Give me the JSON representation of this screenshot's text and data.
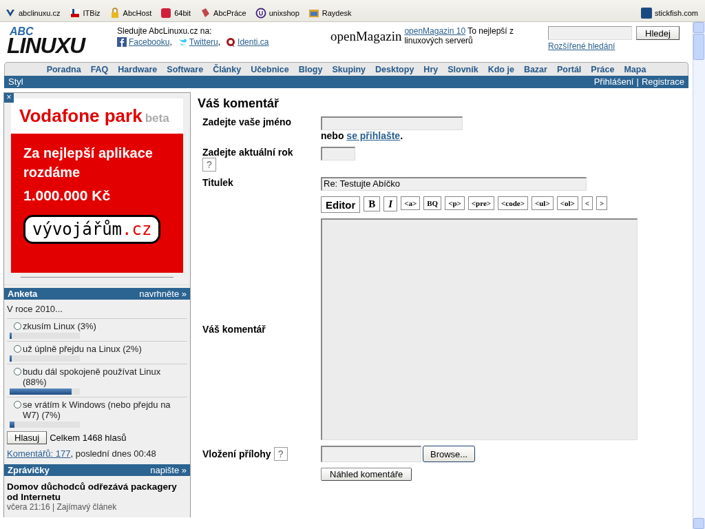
{
  "bookmarks": [
    {
      "label": "abclinuxu.cz",
      "kind": "abc"
    },
    {
      "label": "ITBiz",
      "kind": "itbiz"
    },
    {
      "label": "AbcHost",
      "kind": "lock"
    },
    {
      "label": "64bit",
      "kind": "badge"
    },
    {
      "label": "AbcPráce",
      "kind": "book"
    },
    {
      "label": "unixshop",
      "kind": "ring"
    },
    {
      "label": "Raydesk",
      "kind": "folder"
    }
  ],
  "bookmark_right": {
    "label": "stickfish.com"
  },
  "header": {
    "logo_top": "ABC",
    "logo_bottom": "LINUXU",
    "follow_title": "Sledujte AbcLinuxu.cz na:",
    "follow": [
      {
        "label": "Facebooku",
        "punct": ",",
        "kind": "facebook"
      },
      {
        "label": "Twitteru",
        "punct": ",",
        "kind": "twitter"
      },
      {
        "label": "Identi.ca",
        "kind": "identica"
      }
    ],
    "magazine_logo": "openMagazin",
    "magazine_link": "openMagazin 10",
    "magazine_text": "To nejlepší z linuxových serverů",
    "search_button": "Hledej",
    "search_link": "Rozšířené hledání"
  },
  "nav": [
    "Poradna",
    "FAQ",
    "Hardware",
    "Software",
    "Články",
    "Učebnice",
    "Blogy",
    "Skupiny",
    "Desktopy",
    "Hry",
    "Slovník",
    "Kdo je",
    "Bazar",
    "Portál",
    "Práce",
    "Mapa"
  ],
  "userbar": {
    "left": "Styl",
    "login": "Přihlášení",
    "separator": "|",
    "register": "Registrace"
  },
  "ad": {
    "close": "×",
    "brand": "Vodafone park",
    "tag": "beta",
    "lines": [
      "Za nejlepší aplikace rozdáme",
      "1.000.000 Kč"
    ],
    "bubble": "vývojářům",
    "bubble_tld": ".cz"
  },
  "poll": {
    "title": "Anketa",
    "action": "navrhněte »",
    "question": "V roce 2010...",
    "options": [
      {
        "label": "zkusím Linux (3%)",
        "selected": false,
        "level": 0.03
      },
      {
        "label": "už úplně přejdu na Linux (2%)",
        "selected": false,
        "level": 0.02
      },
      {
        "label": "budu dál spokojeně používat Linux (88%)",
        "selected": false,
        "level": 0.88
      },
      {
        "label": "se vrátím k Windows (nebo přejdu na W7) (7%)",
        "selected": false,
        "level": 0.07
      }
    ],
    "vote": "Hlasuj",
    "total": "Celkem 1468 hlasů",
    "comments_link": "Komentářů: 177",
    "comments_rest": ", poslední dnes 00:48"
  },
  "news": {
    "title": "Zprávičky",
    "action": "napište »",
    "items": [
      {
        "title": "Domov důchodců odřezává packagery od Internetu",
        "meta": "včera 21:16 | Zajímavý článek"
      }
    ]
  },
  "form": {
    "title": "Váš komentář",
    "name_label": "Zadejte vaše jméno",
    "or_text": "nebo",
    "login_link": "se přihlašte",
    "login_end": ".",
    "year_label": "Zadejte aktuální rok",
    "help": "?",
    "subject_label": "Titulek",
    "subject_value": "Re: Testujte Abíčko",
    "toolbar": [
      {
        "label": "Editor",
        "kind": "editor"
      },
      {
        "label": "B",
        "kind": "bold"
      },
      {
        "label": "I",
        "kind": "italic"
      },
      {
        "label": "<a>",
        "kind": "code"
      },
      {
        "label": "BQ",
        "kind": "code"
      },
      {
        "label": "<p>",
        "kind": "code"
      },
      {
        "label": "<pre>",
        "kind": "code"
      },
      {
        "label": "<code>",
        "kind": "code"
      },
      {
        "label": "<ul>",
        "kind": "code"
      },
      {
        "label": "<ol>",
        "kind": "code"
      },
      {
        "label": "<",
        "kind": "code"
      },
      {
        "label": ">",
        "kind": "code"
      }
    ],
    "comment_label": "Váš komentář",
    "attach_label": "Vložení přílohy",
    "attach_help": "?",
    "browse": "Browse...",
    "preview": "Náhled komentáře"
  }
}
